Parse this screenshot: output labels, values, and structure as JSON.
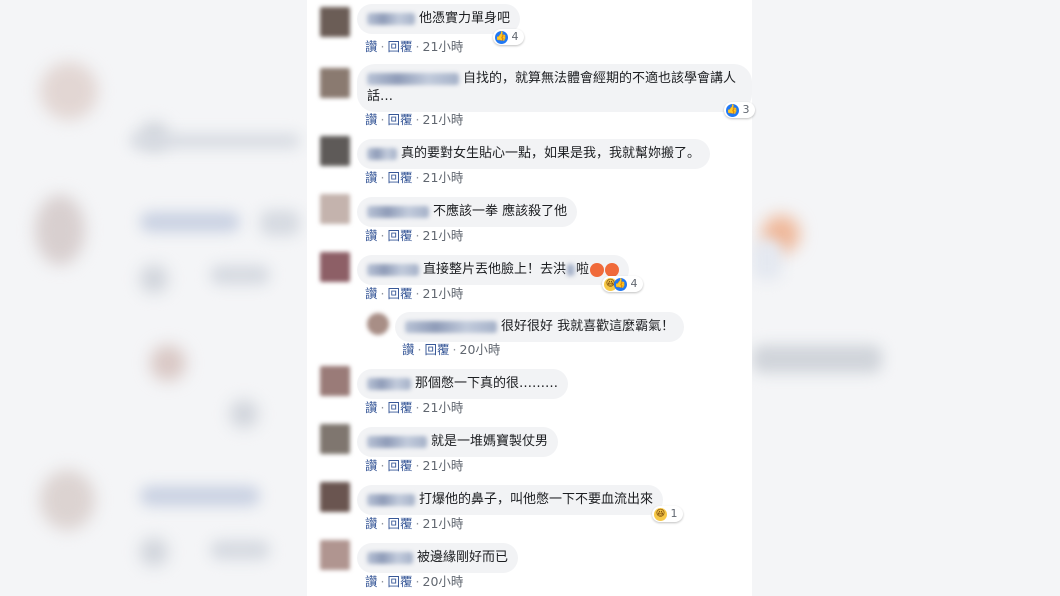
{
  "actions": {
    "like": "讚",
    "reply": "回覆",
    "sep": "·"
  },
  "comments": [
    {
      "text": "他憑實力單身吧",
      "time": "21小時",
      "reaction_count": "4"
    },
    {
      "text": "自找的，就算無法體會經期的不適也該學會講人話…",
      "time": "21小時",
      "reaction_count": "3"
    },
    {
      "text": "真的要對女生貼心一點，如果是我，我就幫妳搬了。",
      "time": "21小時"
    },
    {
      "text": "不應該一拳 應該殺了他",
      "time": "21小時"
    },
    {
      "text": "直接整片丟他臉上！去洪",
      "text_tail": "啦",
      "time": "21小時",
      "reaction_count": "4"
    },
    {
      "text": "很好很好 我就喜歡這麼霸氣！",
      "time": "20小時"
    },
    {
      "text": "那個憋一下真的很………",
      "time": "21小時"
    },
    {
      "text": "就是一堆媽寶製仗男",
      "time": "21小時"
    },
    {
      "text": "打爆他的鼻子，叫他憋一下不要血流出來",
      "time": "21小時",
      "reaction_count": "1"
    },
    {
      "text": "被邊緣剛好而已",
      "time": "20小時"
    }
  ],
  "colors": {
    "link": "#385898",
    "bubble": "#f2f3f5",
    "like": "#2078f4"
  },
  "icons": [
    "like-icon",
    "haha-icon",
    "angry-icon"
  ]
}
